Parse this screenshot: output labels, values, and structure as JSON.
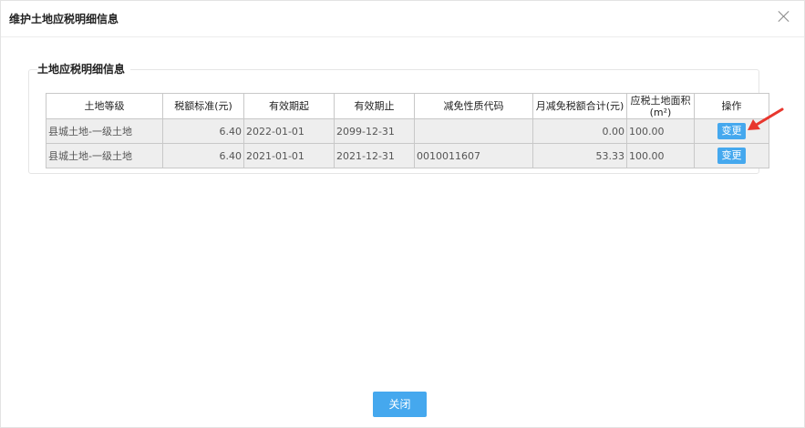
{
  "dialog": {
    "title": "维护土地应税明细信息",
    "close_button_label": "关闭"
  },
  "section": {
    "legend": "土地应税明细信息"
  },
  "table": {
    "headers": [
      "土地等级",
      "税额标准(元)",
      "有效期起",
      "有效期止",
      "减免性质代码",
      "月减免税额合计(元)",
      "应税土地面积(m²)",
      "操作"
    ],
    "rows": [
      {
        "land_grade": "县城土地-一级土地",
        "tax_standard": "6.40",
        "valid_from": "2022-01-01",
        "valid_to": "2099-12-31",
        "exemption_code": "",
        "monthly_exemption_total": "0.00",
        "taxable_area": "100.00",
        "action_label": "变更"
      },
      {
        "land_grade": "县城土地-一级土地",
        "tax_standard": "6.40",
        "valid_from": "2021-01-01",
        "valid_to": "2021-12-31",
        "exemption_code": "0010011607",
        "monthly_exemption_total": "53.33",
        "taxable_area": "100.00",
        "action_label": "变更"
      }
    ]
  },
  "colors": {
    "accent": "#45a8ee",
    "annotation_arrow": "#e8372e"
  },
  "icons": {
    "close": "close-icon",
    "annotation": "arrow-icon"
  }
}
